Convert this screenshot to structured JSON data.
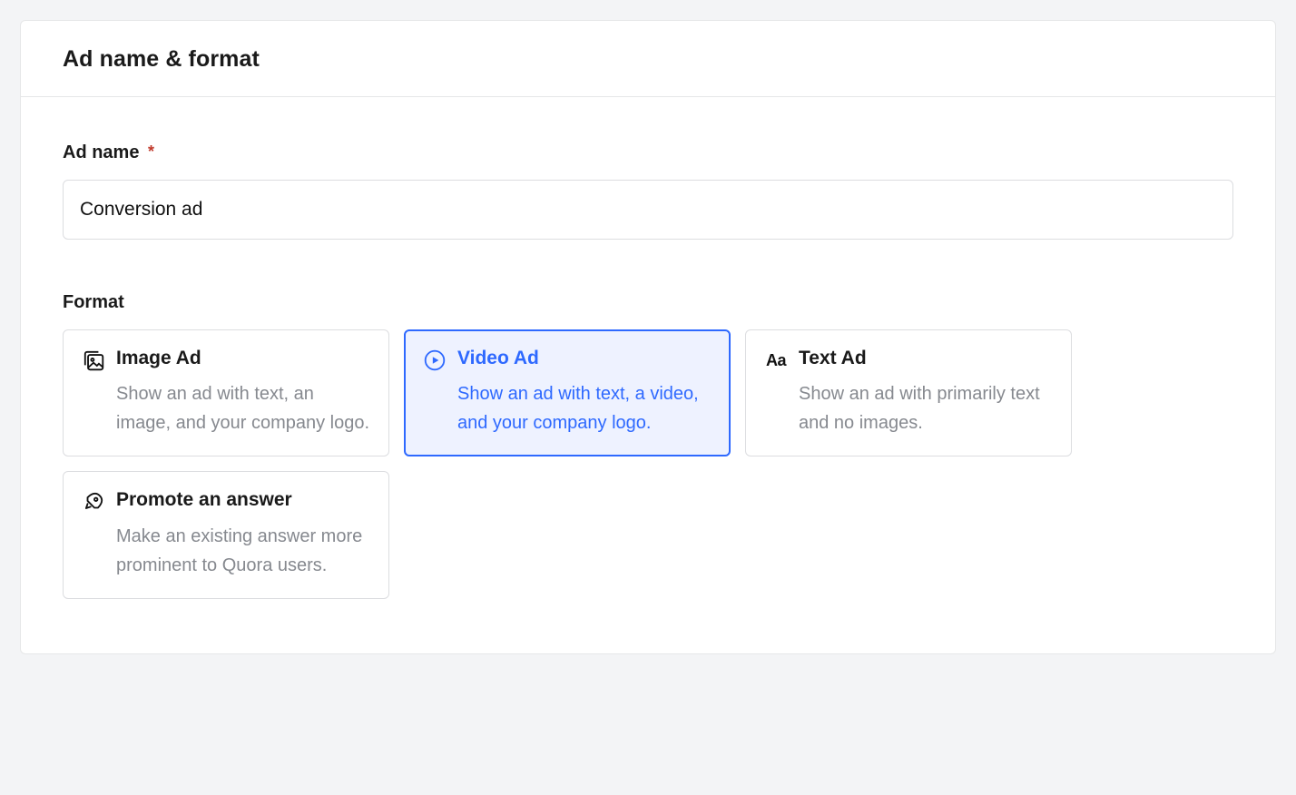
{
  "header": {
    "title": "Ad name & format"
  },
  "adName": {
    "label": "Ad name",
    "required_marker": "*",
    "value": "Conversion ad"
  },
  "format": {
    "label": "Format",
    "selected": 1,
    "options": [
      {
        "title": "Image Ad",
        "desc": "Show an ad with text, an image, and your company logo."
      },
      {
        "title": "Video Ad",
        "desc": "Show an ad with text, a video, and your company logo."
      },
      {
        "title": "Text Ad",
        "desc": "Show an ad with primarily text and no images."
      },
      {
        "title": "Promote an answer",
        "desc": "Make an existing answer more prominent to Quora users."
      }
    ]
  }
}
